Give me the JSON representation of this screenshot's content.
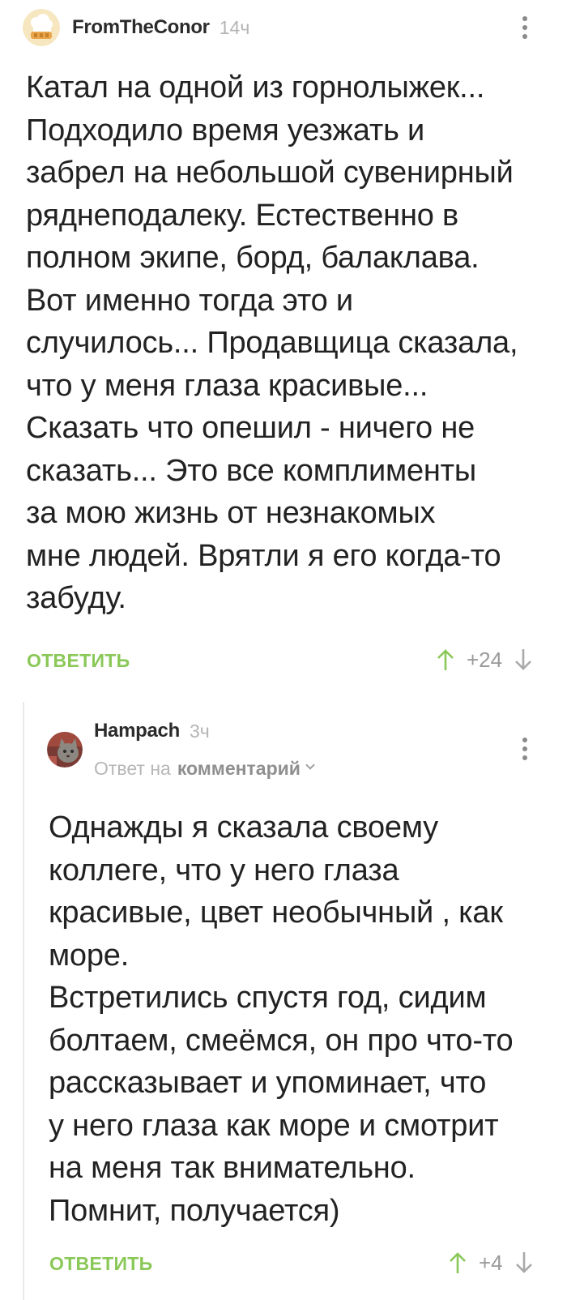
{
  "comments": [
    {
      "author": "FromTheConor",
      "time": "14ч",
      "text": "Катал на одной из горнолыжек...\nПодходило время уезжать и\nзабрел на небольшой сувенирный\nряднеподалеку. Естественно в\nполном экипе, борд, балаклава.\nВот именно тогда это и\nслучилось... Продавщица сказала,\nчто у меня глаза красивые...\nСказать что опешил - ничего не\nсказать... Это все комплименты\nза мою жизнь от незнакомых\nмне людей. Врятли я его когда-то\nзабуду.",
      "reply_label": "ОТВЕТИТЬ",
      "score": "+24",
      "icons": {
        "avatar": "chef-hat-avatar",
        "menu": "kebab-menu-icon",
        "up": "arrow-up-icon",
        "down": "arrow-down-icon"
      }
    },
    {
      "author": "Hampach",
      "time": "3ч",
      "reply_prefix": "Ответ на",
      "reply_target": "комментарий",
      "text": "Однажды я сказала своему\nколлеге, что у него глаза\nкрасивые, цвет необычный , как\nморе.\nВстретились спустя год, сидим\nболтаем, смеёмся, он про что-то\nрассказывает и упоминает, что\nу него глаза как море и смотрит\nна меня так внимательно.\nПомнит, получается)",
      "reply_label": "ОТВЕТИТЬ",
      "score": "+4",
      "icons": {
        "avatar": "cat-photo-avatar",
        "menu": "kebab-menu-icon",
        "up": "arrow-up-icon",
        "down": "arrow-down-icon"
      }
    }
  ],
  "colors": {
    "accent_green": "#8ac858",
    "muted": "#9a9a9a",
    "text": "#222222"
  }
}
